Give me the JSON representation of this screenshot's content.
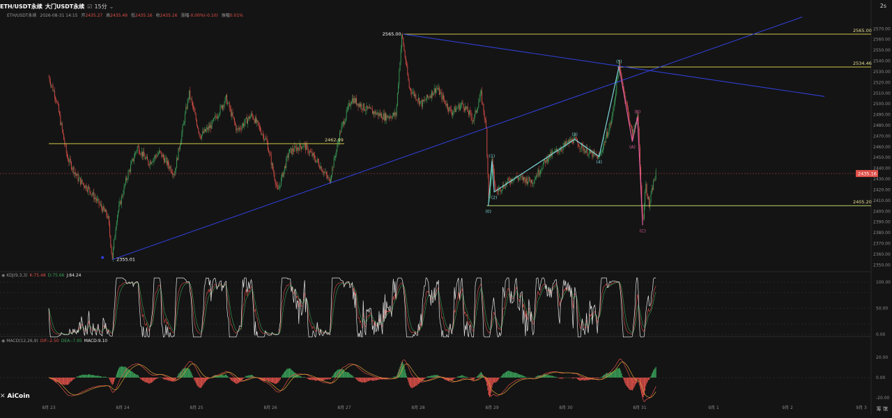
{
  "header": {
    "symbol": "ETH/USDT永续",
    "exchange": "大门USDT永续",
    "timeframe": "15分",
    "time": "2026-08-31 14:15",
    "open_label": "开",
    "open": "2435.27",
    "high_label": "高",
    "high": "2435.49",
    "low_label": "低",
    "low": "2435.16",
    "close_label": "收",
    "close": "2435.16",
    "change_label": "涨幅",
    "change": "-0.00%(-0.10)",
    "amp_label": "振幅",
    "amp": "0.01%",
    "corner": "2s"
  },
  "logo": "AiCoin",
  "corner_bottom": "筹 馆",
  "colors": {
    "bg": "#141414",
    "up": "#3aa35a",
    "down": "#e0504a",
    "wave": "#7fd6dc",
    "wave_alt": "#e05fa0",
    "trend": "#2f3fd6",
    "hline": "#cfc84a",
    "hline_green": "#b8d86a"
  },
  "chart_data": [
    {
      "type": "line",
      "title": "",
      "price_axis": {
        "ticks": [
          2570,
          2560,
          2550,
          2540,
          2530,
          2520,
          2510,
          2500,
          2490,
          2480,
          2470,
          2460,
          2450,
          2440,
          2430,
          2420,
          2410,
          2400,
          2390,
          2380,
          2370,
          2360,
          2350
        ],
        "range": [
          2345,
          2578
        ]
      },
      "x_axis": {
        "ticks": [
          "8月 23",
          "8月 24",
          "8月 25",
          "8月 26",
          "8月 27",
          "8月 28",
          "8月 29",
          "8月 30",
          "8月 31",
          "9月 1",
          "9月 2",
          "9月 3"
        ]
      },
      "price_series": [
        {
          "t": 0,
          "p": 2525
        },
        {
          "t": 0.1,
          "p": 2505
        },
        {
          "t": 0.25,
          "p": 2450
        },
        {
          "t": 0.4,
          "p": 2430
        },
        {
          "t": 0.55,
          "p": 2420
        },
        {
          "t": 0.7,
          "p": 2405
        },
        {
          "t": 0.8,
          "p": 2395
        },
        {
          "t": 0.86,
          "p": 2356
        },
        {
          "t": 0.92,
          "p": 2395
        },
        {
          "t": 1.05,
          "p": 2430
        },
        {
          "t": 1.2,
          "p": 2460
        },
        {
          "t": 1.35,
          "p": 2445
        },
        {
          "t": 1.5,
          "p": 2455
        },
        {
          "t": 1.7,
          "p": 2435
        },
        {
          "t": 1.9,
          "p": 2510
        },
        {
          "t": 2.05,
          "p": 2470
        },
        {
          "t": 2.2,
          "p": 2480
        },
        {
          "t": 2.4,
          "p": 2505
        },
        {
          "t": 2.55,
          "p": 2475
        },
        {
          "t": 2.75,
          "p": 2490
        },
        {
          "t": 2.95,
          "p": 2465
        },
        {
          "t": 3.1,
          "p": 2418
        },
        {
          "t": 3.25,
          "p": 2455
        },
        {
          "t": 3.45,
          "p": 2462
        },
        {
          "t": 3.65,
          "p": 2445
        },
        {
          "t": 3.8,
          "p": 2428
        },
        {
          "t": 3.95,
          "p": 2475
        },
        {
          "t": 4.1,
          "p": 2505
        },
        {
          "t": 4.3,
          "p": 2495
        },
        {
          "t": 4.55,
          "p": 2488
        },
        {
          "t": 4.7,
          "p": 2490
        },
        {
          "t": 4.78,
          "p": 2565
        },
        {
          "t": 4.88,
          "p": 2515
        },
        {
          "t": 5.05,
          "p": 2500
        },
        {
          "t": 5.25,
          "p": 2515
        },
        {
          "t": 5.45,
          "p": 2492
        },
        {
          "t": 5.6,
          "p": 2500
        },
        {
          "t": 5.75,
          "p": 2485
        },
        {
          "t": 5.85,
          "p": 2510
        },
        {
          "t": 5.92,
          "p": 2478
        },
        {
          "t": 5.96,
          "p": 2405
        },
        {
          "t": 6.0,
          "p": 2447
        },
        {
          "t": 6.05,
          "p": 2418
        },
        {
          "t": 6.3,
          "p": 2432
        },
        {
          "t": 6.55,
          "p": 2428
        },
        {
          "t": 6.75,
          "p": 2450
        },
        {
          "t": 7.1,
          "p": 2467
        },
        {
          "t": 7.3,
          "p": 2455
        },
        {
          "t": 7.45,
          "p": 2450
        },
        {
          "t": 7.62,
          "p": 2485
        },
        {
          "t": 7.72,
          "p": 2535
        },
        {
          "t": 7.82,
          "p": 2500
        },
        {
          "t": 7.9,
          "p": 2470
        },
        {
          "t": 7.97,
          "p": 2490
        },
        {
          "t": 8.04,
          "p": 2388
        },
        {
          "t": 8.08,
          "p": 2425
        },
        {
          "t": 8.13,
          "p": 2405
        },
        {
          "t": 8.18,
          "p": 2425
        },
        {
          "t": 8.22,
          "p": 2435
        }
      ],
      "horizontal_lines": [
        {
          "price": 2565.0,
          "label": "2565.00",
          "style": "yellow",
          "from": 4.8,
          "to": 12
        },
        {
          "price": 2534.46,
          "label": "2534.46",
          "style": "yellow",
          "from": 7.7,
          "to": 12
        },
        {
          "price": 2462.99,
          "label": "2462.99",
          "style": "yellow",
          "from": 0,
          "to": 4.0
        },
        {
          "price": 2405.2,
          "label": "2405.20",
          "style": "green",
          "from": 5.93,
          "to": 12
        },
        {
          "price": 2435.16,
          "label": "2435.16",
          "style": "current",
          "from": 0,
          "to": 12
        }
      ],
      "trend_lines": [
        {
          "from": {
            "t": 0.86,
            "p": 2355
          },
          "to": {
            "t": 10.2,
            "p": 2581
          }
        },
        {
          "from": {
            "t": 4.8,
            "p": 2565
          },
          "to": {
            "t": 10.5,
            "p": 2507
          }
        }
      ],
      "price_labels": [
        {
          "t": 4.8,
          "p": 2565,
          "text": "2565.00",
          "side": "left"
        },
        {
          "t": 0.86,
          "p": 2355.01,
          "text": "2355.01",
          "side": "right"
        }
      ],
      "wave_impulse": [
        {
          "t": 5.95,
          "p": 2405,
          "label": "(0)"
        },
        {
          "t": 6.0,
          "p": 2447,
          "label": "(1)"
        },
        {
          "t": 6.03,
          "p": 2418,
          "label": "(2)"
        },
        {
          "t": 7.12,
          "p": 2467,
          "label": "(3)"
        },
        {
          "t": 7.45,
          "p": 2451,
          "label": "(4)"
        },
        {
          "t": 7.72,
          "p": 2535,
          "label": "(5)"
        }
      ],
      "wave_correction": [
        {
          "t": 7.72,
          "p": 2535,
          "label": ""
        },
        {
          "t": 7.9,
          "p": 2465,
          "label": "(A)"
        },
        {
          "t": 7.97,
          "p": 2488,
          "label": "(B)"
        },
        {
          "t": 8.04,
          "p": 2387,
          "label": "(C)"
        }
      ]
    },
    {
      "type": "line",
      "title": "KDJ(9,3,3)",
      "legend": [
        {
          "name": "K:75.48",
          "color": "#e0504a"
        },
        {
          "name": "D:75.66",
          "color": "#3aa35a"
        },
        {
          "name": "J:84.24",
          "color": "#e8e8e8"
        }
      ],
      "ylim": [
        0,
        100
      ],
      "y_ticks": [
        "100.00",
        "50.00",
        "0.00"
      ]
    },
    {
      "type": "bar",
      "title": "MACD(12,26,9)",
      "legend": [
        {
          "name": "DIF:-2.50",
          "color": "#e0504a"
        },
        {
          "name": "DEA:-7.95",
          "color": "#3aa35a"
        },
        {
          "name": "MACD:9.10",
          "color": "#e8e8e8"
        }
      ],
      "y_ticks": [
        "20.00",
        "0.00",
        "-20.00"
      ]
    }
  ]
}
